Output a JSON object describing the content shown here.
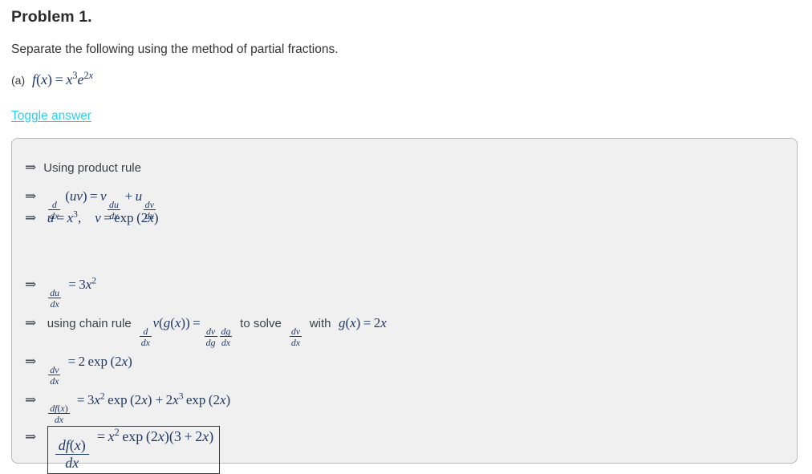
{
  "document": {
    "title": "Problem 1.",
    "prompt": "Separate the following using the method of partial fractions.",
    "part_label": "(a)",
    "part_equation_plain": "f(x) = x^3 e^{2x}",
    "toggle_link": "Toggle answer"
  },
  "answer": {
    "lines": [
      {
        "id": "product-rule-statement",
        "arrow": "⇒",
        "text": "Using product rule",
        "plain": "=> Using product rule"
      },
      {
        "id": "product-rule-formula",
        "arrow": "⇒",
        "plain": "=> d/dx (uv) = v du/dx + u dv/dx"
      },
      {
        "id": "u-v-definitions",
        "arrow": "⇒",
        "plain": "=> u = x^3,   v = exp(2x)"
      },
      {
        "id": "du-dx",
        "arrow": "⇒",
        "plain": "=> du/dx = 3x^2"
      },
      {
        "id": "chain-rule-statement",
        "arrow": "⇒",
        "text_before": "using chain rule",
        "text_middle": "to solve",
        "text_after": "with",
        "plain": "=> using chain rule d/dx v(g(x)) = dv/dg dg/dx to solve dv/dx with g(x) = 2x"
      },
      {
        "id": "dv-dx",
        "arrow": "⇒",
        "plain": "=> dv/dx = 2 exp(2x)"
      },
      {
        "id": "df-dx-expanded",
        "arrow": "⇒",
        "plain": "=> df(x)/dx = 3x^2 exp(2x) + 2x^3 exp(2x)"
      },
      {
        "id": "df-dx-final-boxed",
        "arrow": "⇒",
        "plain": "=> df(x)/dx = x^2 exp(2x)(3 + 2x)",
        "boxed": true
      }
    ],
    "symbols": {
      "implies": "⇒",
      "equals": "=",
      "plus": "+",
      "comma": ",",
      "exp": "exp",
      "d": "d",
      "u": "u",
      "v": "v",
      "g": "g",
      "x": "x",
      "f": "f",
      "two": "2",
      "three": "3",
      "lparen": "(",
      "rparen": ")"
    }
  },
  "colors": {
    "page_background": "#ffffff",
    "text": "#333333",
    "heading": "#2b2b2b",
    "link": "#29d2f0",
    "panel_background": "#f0f0f0",
    "panel_border": "#b9b9b9",
    "math": "#1f3864",
    "boxed_border": "#3a3a3a"
  }
}
